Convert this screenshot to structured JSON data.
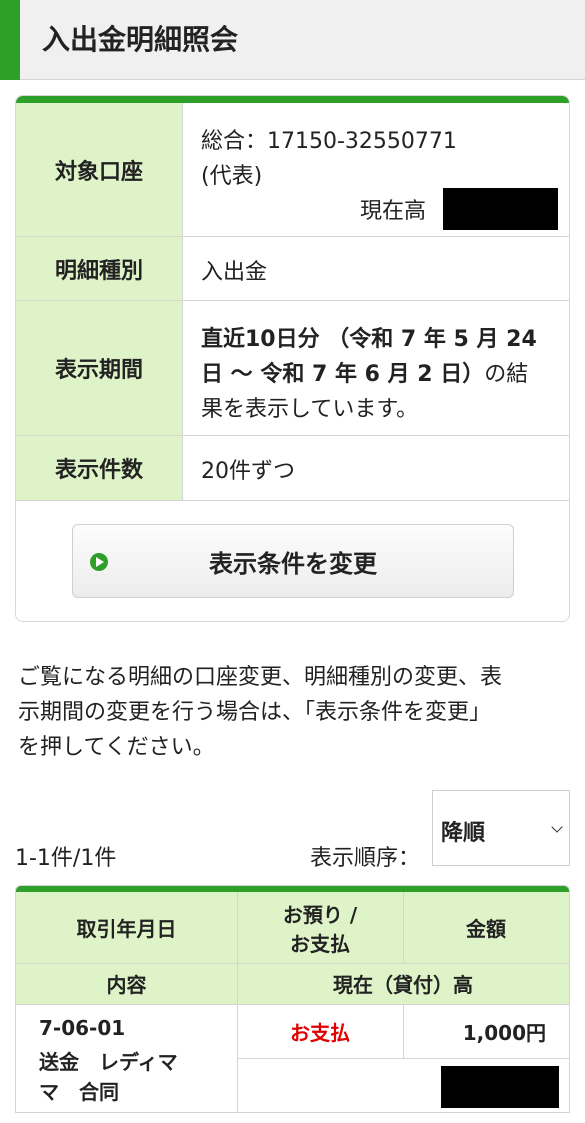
{
  "page": {
    "title": "入出金明細照会"
  },
  "account_panel": {
    "account_label": "対象口座",
    "account_line1": "総合：17150-32550771",
    "account_line2": "(代表)",
    "balance_label": "現在高",
    "type_label": "明細種別",
    "type_value": "入出金",
    "period_label": "表示期間",
    "period_bold_1": "直近10日分 （令和 7 年 5 月 24",
    "period_bold_2": "日 〜 令和 7 年 6 月 2 日）",
    "period_rest_2": "の結",
    "period_line3": "果を表示しています。",
    "count_label": "表示件数",
    "count_value": "20件ずつ",
    "change_button": "表示条件を変更"
  },
  "note": {
    "line1": "ご覧になる明細の口座変更、明細種別の変更、表",
    "line2": "示期間の変更を行う場合は、「表示条件を変更」",
    "line3": "を押してください。"
  },
  "list_controls": {
    "result_count": "1-1件/1件",
    "sort_label": "表示順序：",
    "sort_value": "降順"
  },
  "table": {
    "headers": {
      "date": "取引年月日",
      "deposit_line1": "お預り /",
      "deposit_line2": "お支払",
      "amount": "金額",
      "content": "内容",
      "balance": "現在（貸付）高"
    },
    "rows": [
      {
        "date": "7-06-01",
        "content_line1": "送金　レディマ",
        "content_line2": "マ　合同",
        "type": "お支払",
        "amount": "1,000円"
      }
    ]
  },
  "colors": {
    "accent": "#2ea02a",
    "label_bg": "#dff3c8",
    "payment_red": "#e00000"
  },
  "icons": {
    "button_icon": "play-circle-icon",
    "sort_icon": "chevron-down-icon"
  }
}
